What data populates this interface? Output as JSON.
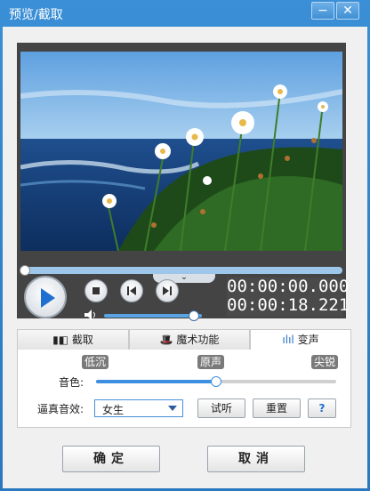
{
  "window": {
    "title": "预览/截取",
    "minimize_glyph": "−",
    "close_glyph": "✕"
  },
  "player": {
    "current_time": "00:00:00.000",
    "total_time": "00:00:18.221",
    "seek_progress": 0.0,
    "volume_level": 0.95,
    "notch_glyph": "⌄"
  },
  "tabs": [
    {
      "label": "截取",
      "icon": "film-icon"
    },
    {
      "label": "魔术功能",
      "icon": "magic-hat-icon"
    },
    {
      "label": "变声",
      "icon": "sound-wave-icon",
      "active": true
    }
  ],
  "voice": {
    "low_label": "低沉",
    "mid_label": "原声",
    "high_label": "尖锐",
    "timbre_label": "音色:",
    "timbre_level": 0.5,
    "effect_label": "逼真音效:",
    "effect_value": "女生",
    "listen_button": "试听",
    "reset_button": "重置",
    "help_glyph": "?"
  },
  "footer": {
    "ok_button": "确定",
    "cancel_button": "取消"
  },
  "colors": {
    "title_bar": "#2a78c0",
    "accent": "#3d8fe0",
    "play": "#1f6fd0"
  }
}
